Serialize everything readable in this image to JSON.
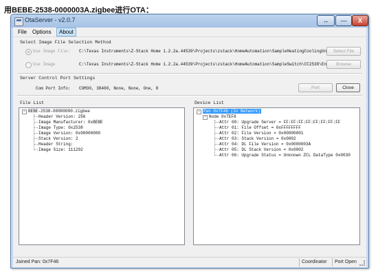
{
  "caption": "用BEBE-2538-0000003A.zigbee进行OTA：",
  "window": {
    "title": "OtaServer - v2.0.7",
    "controls": {
      "restore": "↔",
      "minimize": "—",
      "close": "X"
    }
  },
  "menu": [
    "File",
    "Options",
    "About"
  ],
  "image_selection": {
    "heading": "Select Image File Selection Method",
    "use_image_file_label": "Use Image File:",
    "use_image_file_path": "C:\\Texas Instruments\\Z-Stack Home 1.2.2a.44539\\Projects\\zstack\\HomeAutomation\\SampleHeatingCoolingUni",
    "select_file_button": "Select File",
    "use_image_label": "Use Image",
    "use_image_path": "C:\\Texas Instruments\\Z-Stack Home 1.2.2a.44539\\Projects\\zstack\\HomeAutomation\\SampleSwitch\\CC2538\\End",
    "browse_button": "Browse"
  },
  "server_port": {
    "heading": "Server Control Port Settings",
    "com_port_label": "Com Port Info:",
    "com_port_value": "COM30, 38400, None, None, One, 8",
    "port_button": "Port",
    "close_button": "Close"
  },
  "file_list": {
    "title": "File List",
    "root": "BEBE-2538-00000000.zigbee",
    "items": [
      "Header Version: 256",
      "Image Manufacturer: 0xBEBE",
      "Image Type: 0x2538",
      "Image Version: 0x00000000",
      "Stack Version: 2",
      "Header String:",
      "Image Size: 111292"
    ]
  },
  "device_list": {
    "title": "Device List",
    "pan": "Pan 0x7F46 (In Network)",
    "node": "Node 0xTEF8",
    "attrs": [
      "Attr 00: Upgrade Server = FF:FF:FF:FF:FF:FF:FF:FF",
      "Attr 01: File Offset = 0xFFFFFFFF",
      "Attr 02: File Version = 0x00000001",
      "Attr 03: Stack Version = 0x0002",
      "Attr 04: DL File Version = 0x0000003A",
      "Attr 05: DL Stack Version = 0x0002",
      "Attr 06: Upgrade Status = Unknown ZCL DataType 0x0030"
    ]
  },
  "statusbar": {
    "left": "Joined Pan: 0x7F46",
    "role": "Coordinator",
    "port": "Port Open"
  },
  "colors": {
    "titlebar": "#a7c3e6",
    "selection": "#3399ff",
    "close_button": "#c6432f"
  }
}
